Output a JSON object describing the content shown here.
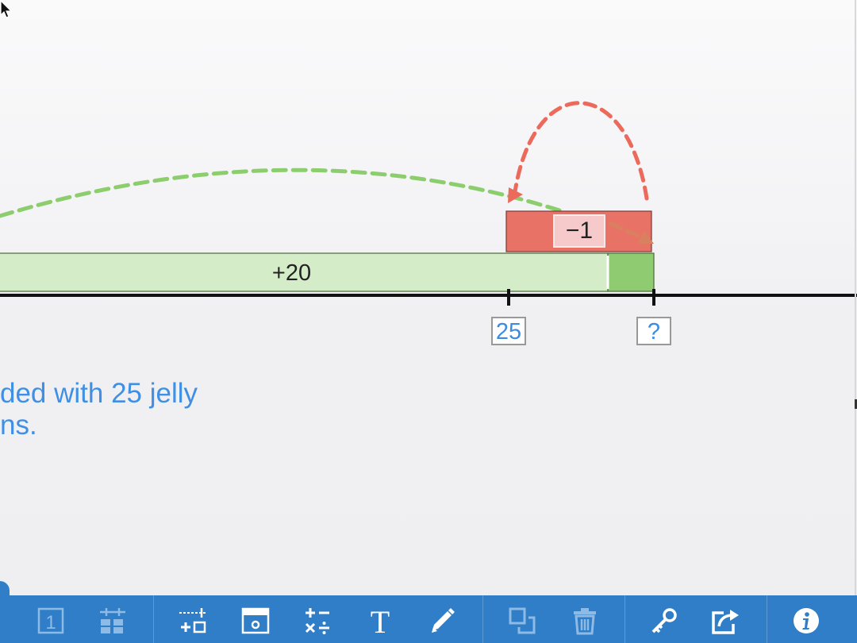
{
  "number_line": {
    "marks": [
      {
        "label": "25",
        "value": 25
      },
      {
        "label": "?",
        "value": null
      }
    ]
  },
  "bars": {
    "add": {
      "label": "+20",
      "value": 20
    },
    "subtract": {
      "label": "−1",
      "value": -1
    }
  },
  "story_text": {
    "line1": "ded with 25 jelly",
    "line2": "ns."
  },
  "colors": {
    "add_bar_light": "#d4ecc8",
    "add_bar_dark": "#8fcb70",
    "subtract_bar": "#e97266",
    "subtract_box": "#f6caca",
    "green_arc": "#8ccd6e",
    "red_arc": "#ec6a5c",
    "text_blue": "#3f8fe4",
    "toolbar": "#2f7ec7",
    "toolbar_icon": "#ffffff",
    "toolbar_icon_dim": "#8dbbe6"
  },
  "toolbar": {
    "buttons": [
      {
        "name": "number-1-icon",
        "enabled": false
      },
      {
        "name": "grid-blocks-icon",
        "enabled": false
      },
      {
        "name": "numberline-add-icon",
        "enabled": true
      },
      {
        "name": "calendar-box-icon",
        "enabled": true
      },
      {
        "name": "operations-icon",
        "enabled": true
      },
      {
        "name": "text-tool-icon",
        "enabled": true
      },
      {
        "name": "pencil-icon",
        "enabled": true
      },
      {
        "name": "duplicate-icon",
        "enabled": false
      },
      {
        "name": "trash-icon",
        "enabled": false
      },
      {
        "name": "key-icon",
        "enabled": true
      },
      {
        "name": "share-icon",
        "enabled": true
      },
      {
        "name": "info-icon",
        "enabled": true
      }
    ]
  }
}
